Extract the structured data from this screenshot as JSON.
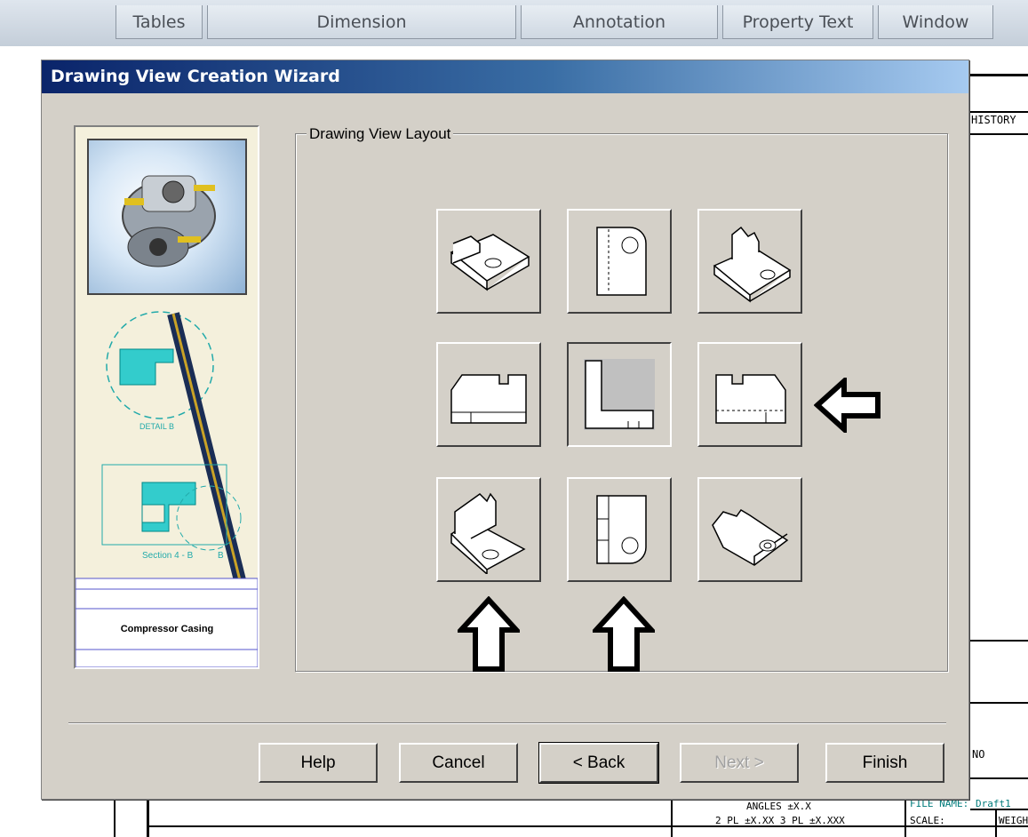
{
  "ribbon": {
    "tabs": [
      {
        "label": "Tables"
      },
      {
        "label": "Dimension"
      },
      {
        "label": "Annotation"
      },
      {
        "label": "Property Text"
      },
      {
        "label": "Window"
      }
    ]
  },
  "background_drawing": {
    "history_label": "HISTORY",
    "no_label": "NO",
    "file_name_label": "FILE NAME:",
    "file_name_value": "Draft1",
    "angles_text": "ANGLES ±X.X",
    "tolerance_text": "2 PL ±X.XX 3 PL ±X.XXX",
    "scale_label": "SCALE:",
    "weight_label": "WEIGHT"
  },
  "dialog": {
    "title": "Drawing View Creation Wizard",
    "side_panel": {
      "detail_label": "DETAIL B",
      "section_label": "Section 4 - B",
      "section_letter": "B",
      "title_block_text": "Compressor Casing"
    },
    "layout_group_label": "Drawing View Layout",
    "view_buttons": [
      {
        "name": "iso-top-left",
        "pressed": false
      },
      {
        "name": "top-view",
        "pressed": false
      },
      {
        "name": "iso-top-right",
        "pressed": false
      },
      {
        "name": "left-view",
        "pressed": false
      },
      {
        "name": "front-view",
        "pressed": true
      },
      {
        "name": "right-view",
        "pressed": false
      },
      {
        "name": "iso-bottom-left",
        "pressed": false
      },
      {
        "name": "bottom-view",
        "pressed": false
      },
      {
        "name": "iso-bottom-right",
        "pressed": false
      }
    ],
    "buttons": {
      "help": "Help",
      "cancel": "Cancel",
      "back": "< Back",
      "next": "Next >",
      "finish": "Finish"
    }
  },
  "colors": {
    "dialog_face": "#d4d0c8",
    "title_gradient_start": "#0a246a",
    "title_gradient_end": "#a6caf0",
    "section_hatch": "#33cccc"
  }
}
